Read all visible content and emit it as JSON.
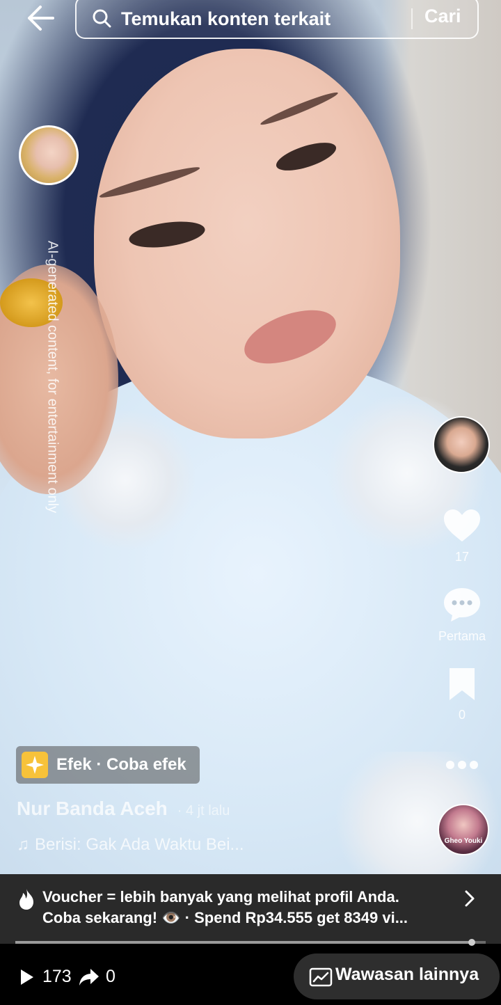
{
  "search": {
    "placeholder": "Temukan konten terkait",
    "button_label": "Cari"
  },
  "video": {
    "ai_label": "AI-generated content, for entertainment only",
    "effect_label": "Efek · Coba efek",
    "author": "Nur Banda Aceh",
    "posted_time": "· 4 jt lalu",
    "music": "Berisi: Gak Ada Waktu Bei..."
  },
  "side_rail": {
    "likes": "17",
    "comments_label": "Pertama",
    "saves": "0",
    "music_disc_text": "Gheo Youki"
  },
  "promo": {
    "line1": "Voucher = lebih banyak yang melihat profil Anda.",
    "line2": "Coba sekarang! 👁️ · Spend Rp34.555 get 8349 vi..."
  },
  "playback": {
    "progress_percent": 97
  },
  "bottom": {
    "views": "173",
    "shares": "0",
    "insights_label": "Wawasan lainnya"
  },
  "colors": {
    "effect_icon": "#f7c23a",
    "promo_bg": "#2a2a2a",
    "bottom_bg": "#000000"
  }
}
